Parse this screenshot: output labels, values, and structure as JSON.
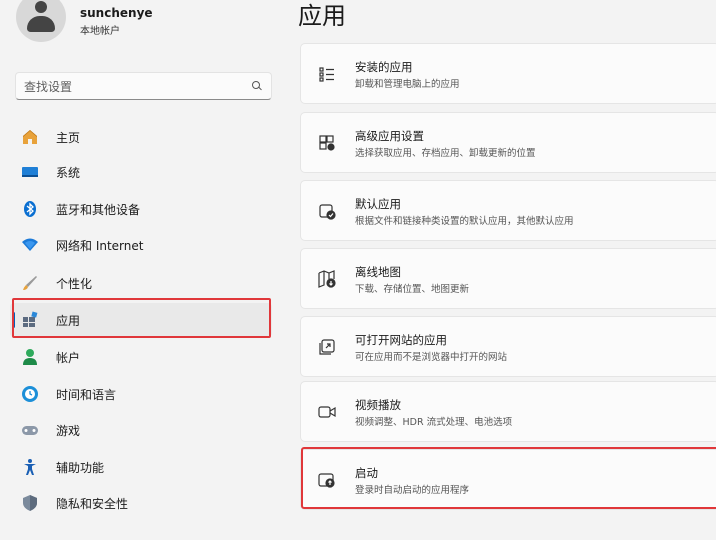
{
  "profile": {
    "name": "sunchenye",
    "subtitle": "本地帐户"
  },
  "search": {
    "placeholder": "查找设置"
  },
  "sidebar": {
    "items": [
      {
        "label": "主页"
      },
      {
        "label": "系统"
      },
      {
        "label": "蓝牙和其他设备"
      },
      {
        "label": "网络和 Internet"
      },
      {
        "label": "个性化"
      },
      {
        "label": "应用"
      },
      {
        "label": "帐户"
      },
      {
        "label": "时间和语言"
      },
      {
        "label": "游戏"
      },
      {
        "label": "辅助功能"
      },
      {
        "label": "隐私和安全性"
      }
    ]
  },
  "main": {
    "title": "应用",
    "cards": [
      {
        "title": "安装的应用",
        "subtitle": "卸载和管理电脑上的应用"
      },
      {
        "title": "高级应用设置",
        "subtitle": "选择获取应用、存档应用、卸载更新的位置"
      },
      {
        "title": "默认应用",
        "subtitle": "根据文件和链接种类设置的默认应用，其他默认应用"
      },
      {
        "title": "离线地图",
        "subtitle": "下载、存储位置、地图更新"
      },
      {
        "title": "可打开网站的应用",
        "subtitle": "可在应用而不是浏览器中打开的网站"
      },
      {
        "title": "视频播放",
        "subtitle": "视频调整、HDR 流式处理、电池选项"
      },
      {
        "title": "启动",
        "subtitle": "登录时自动启动的应用程序"
      }
    ]
  },
  "colors": {
    "accent": "#005fb8",
    "highlight": "#e0373a"
  }
}
